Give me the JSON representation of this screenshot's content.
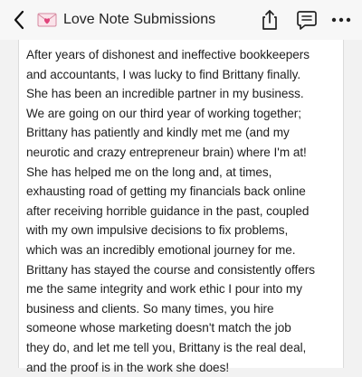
{
  "header": {
    "back_icon": "chevron-left-icon",
    "title_icon": "heart-envelope-icon",
    "title": "Love Note Submissions",
    "share_icon": "share-icon",
    "comment_icon": "comment-icon",
    "more_icon": "more-horizontal-icon",
    "accent_color": "#e0437a"
  },
  "note": {
    "lines": [
      "After years of dishonest and ineffective bookkeepers",
      "and accountants, I was lucky to find Brittany finally.",
      "She has been an incredible partner in my business.",
      "We are going on our third year of working together;",
      "Brittany has patiently and kindly met me (and my",
      "neurotic and crazy entrepreneur brain) where I'm at!",
      "She has helped me on the long and, at times,",
      "exhausting road of getting my financials back online",
      "after receiving horrible guidance in the past, coupled",
      "with my own impulsive decisions to fix problems,",
      "which was an incredibly emotional journey for me.",
      "Brittany has stayed the course and consistently offers",
      "me the same integrity and work ethic I pour into my",
      "business and clients. So many times, you hire",
      "someone whose marketing doesn't match the job",
      "they do, and let me tell you, Brittany is the real deal,",
      "and the proof is in the work she does!"
    ]
  }
}
